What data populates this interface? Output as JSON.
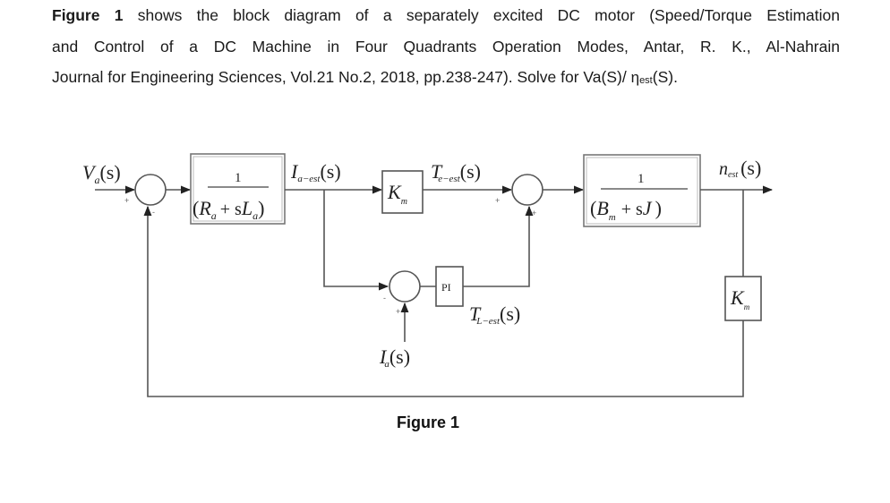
{
  "problem": {
    "line1_bold": "Figure 1",
    "line1_rest": " shows the block diagram of a separately excited DC motor (Speed/Torque Estimation",
    "line2": "and Control of a DC Machine in Four Quadrants Operation Modes, Antar, R. K., Al-Nahrain",
    "line3_pre": "Journal for Engineering Sciences, Vol.21 No.2, 2018, pp.238-247). Solve for Va(S)/ ",
    "line3_eta": "η",
    "line3_sub": "est",
    "line3_post": "(S)."
  },
  "diagram": {
    "input_label": {
      "main": "V",
      "sub": "a",
      "arg": "(s)"
    },
    "block1": {
      "numerator": "1",
      "den_open": "(",
      "den_R": "R",
      "den_R_sub": "a",
      "den_plus": "+ s",
      "den_L": "L",
      "den_L_sub": "a",
      "den_close": ")"
    },
    "ia_est_label": {
      "main": "I",
      "sub": "a−est",
      "arg": "(s)"
    },
    "km_block": {
      "main": "K",
      "sub": "m"
    },
    "te_est_label": {
      "main": "T",
      "sub": "e−est",
      "arg": "(s)"
    },
    "block2": {
      "numerator": "1",
      "den_open": "(",
      "den_B": "B",
      "den_B_sub": "m",
      "den_plus": "+ s",
      "den_J": "J",
      "den_close": ")"
    },
    "output_label": {
      "main": "n",
      "sub": "est",
      "arg": "(s)"
    },
    "km_feedback_block": {
      "main": "K",
      "sub": "m"
    },
    "pi_block": {
      "label": "PI"
    },
    "tl_est_label": {
      "main": "T",
      "sub": "L−est",
      "arg": "(s)"
    },
    "ia_input_label": {
      "main": "I",
      "sub": "a",
      "arg": "(s)"
    },
    "signs": {
      "sum1_input": "+",
      "sum1_feedback": "-",
      "sum2_te": "+",
      "sum2_tl": "+",
      "sum3_ia_est": "-",
      "sum3_ia": "+"
    }
  },
  "caption": "Figure 1"
}
